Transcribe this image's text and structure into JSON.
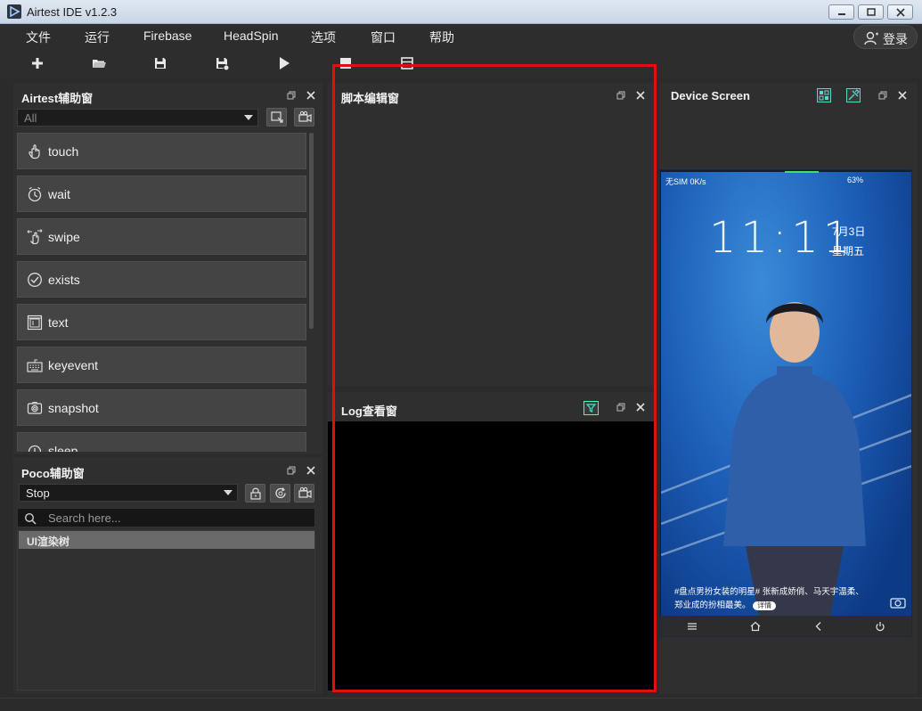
{
  "window": {
    "title": "Airtest IDE v1.2.3"
  },
  "menu": {
    "items": [
      "文件",
      "运行",
      "Firebase",
      "HeadSpin",
      "选项",
      "窗口",
      "帮助"
    ],
    "login": "登录"
  },
  "toolbar": {
    "icons": [
      "new-file-icon",
      "open-folder-icon",
      "save-icon",
      "save-as-icon",
      "run-icon",
      "stop-icon",
      "report-icon"
    ]
  },
  "airtest_panel": {
    "title": "Airtest辅助窗",
    "filter_value": "All",
    "commands": [
      {
        "label": "touch",
        "icon": "touch-hand-icon"
      },
      {
        "label": "wait",
        "icon": "clock-icon"
      },
      {
        "label": "swipe",
        "icon": "swipe-icon"
      },
      {
        "label": "exists",
        "icon": "check-circle-icon"
      },
      {
        "label": "text",
        "icon": "text-input-icon"
      },
      {
        "label": "keyevent",
        "icon": "keyboard-icon"
      },
      {
        "label": "snapshot",
        "icon": "camera-icon"
      },
      {
        "label": "sleep",
        "icon": "sleep-icon"
      }
    ]
  },
  "poco_panel": {
    "title": "Poco辅助窗",
    "mode_value": "Stop",
    "search_placeholder": "Search here...",
    "tree_root": "UI渲染树"
  },
  "script_panel": {
    "title": "脚本编辑窗"
  },
  "log_panel": {
    "title": "Log查看窗"
  },
  "device_panel": {
    "title": "Device Screen",
    "status_left": "无SIM 0K/s",
    "status_right": "63%",
    "clock": "11:11",
    "date_line1": "7月3日",
    "date_line2": "星期五",
    "caption_line1": "#盘点男扮女装的明星# 张新成娇俏、马天宇温柔、",
    "caption_line2": "郑业成的扮相最美。",
    "caption_button": "详情"
  },
  "colors": {
    "highlight_border": "#e01010",
    "log_bg": "#000000",
    "panel_bg": "#2f2f2f"
  }
}
